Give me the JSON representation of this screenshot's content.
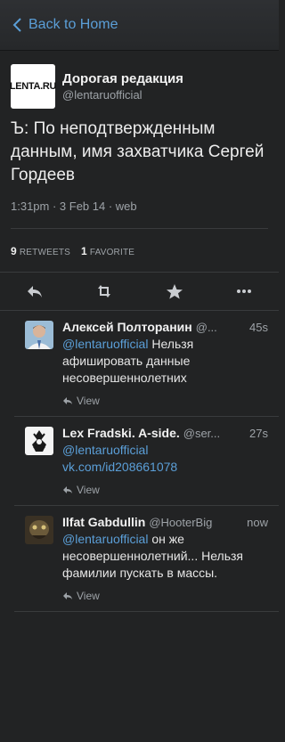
{
  "nav": {
    "back_label": "Back to Home"
  },
  "tweet": {
    "logo_text": "LENTA.RU",
    "author_name": "Дорогая редакция",
    "author_handle": "@lentaruofficial",
    "text": "Ъ: По неподтвержденным данным, имя захватчика Сергей Гордеев",
    "meta": "1:31pm · 3 Feb 14 · web",
    "retweets_count": "9",
    "retweets_label": "RETWEETS",
    "favorites_count": "1",
    "favorites_label": "FAVORITE"
  },
  "actions": [
    "reply-icon",
    "retweet-icon",
    "favorite-star-icon",
    "more-icon"
  ],
  "replies": [
    {
      "name": "Алексей Полторанин",
      "handle": "@...",
      "time": "45s",
      "mention": "@lentaruofficial",
      "text": " Нельзя афишировать данные несовершеннолетних",
      "view_label": "View"
    },
    {
      "name": "Lex Fradski. A-side.",
      "handle": "@ser...",
      "time": "27s",
      "mention": "@lentaruofficial",
      "link": "vk.com/id208661078",
      "view_label": "View"
    },
    {
      "name": "Ilfat Gabdullin",
      "handle": "@HooterBig",
      "time": "now",
      "mention": "@lentaruofficial",
      "text": " он же несовершеннолетний... Нельзя фамилии пускать в массы.",
      "view_label": "View"
    }
  ],
  "colors": {
    "accent": "#5b9fd8",
    "background": "#222324",
    "muted": "#9ea3a8"
  }
}
